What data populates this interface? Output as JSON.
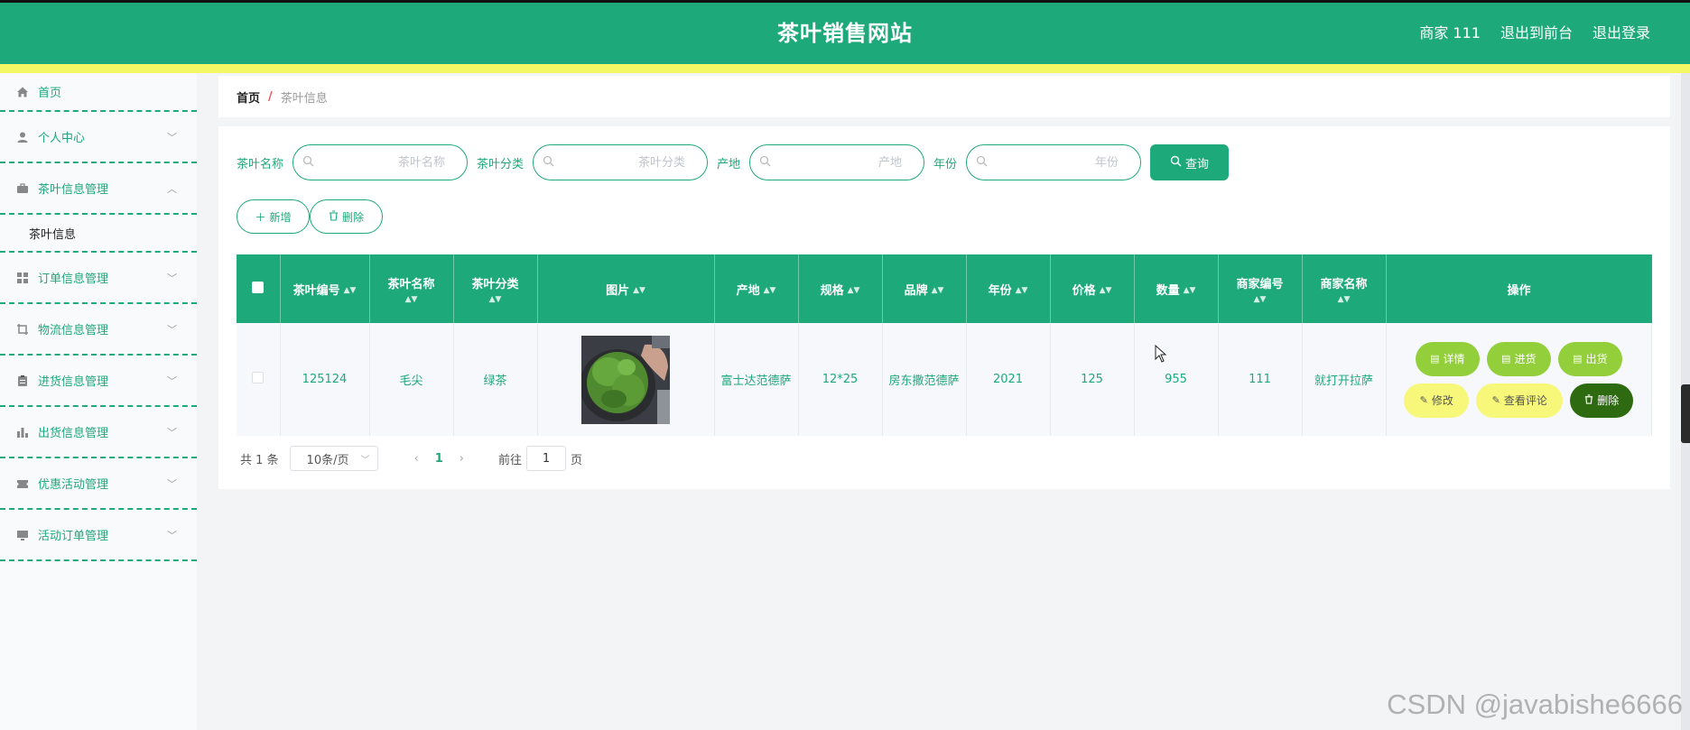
{
  "header": {
    "title": "茶叶销售网站",
    "user": "商家 111",
    "to_front": "退出到前台",
    "logout": "退出登录"
  },
  "sidebar": {
    "items": [
      {
        "label": "首页",
        "icon": "home-icon"
      },
      {
        "label": "个人中心",
        "icon": "user-icon"
      },
      {
        "label": "茶叶信息管理",
        "icon": "briefcase-icon",
        "expanded": true,
        "sub": "茶叶信息"
      },
      {
        "label": "订单信息管理",
        "icon": "grid-icon"
      },
      {
        "label": "物流信息管理",
        "icon": "crop-icon"
      },
      {
        "label": "进货信息管理",
        "icon": "clipboard-icon"
      },
      {
        "label": "出货信息管理",
        "icon": "bar-chart-icon"
      },
      {
        "label": "优惠活动管理",
        "icon": "ticket-icon"
      },
      {
        "label": "活动订单管理",
        "icon": "monitor-icon"
      }
    ]
  },
  "breadcrumb": {
    "home": "首页",
    "sep": "/",
    "current": "茶叶信息"
  },
  "search": {
    "name_label": "茶叶名称",
    "name_placeholder": "茶叶名称",
    "category_label": "茶叶分类",
    "category_placeholder": "茶叶分类",
    "origin_label": "产地",
    "origin_placeholder": "产地",
    "year_label": "年份",
    "year_placeholder": "年份",
    "query": "查询"
  },
  "actions": {
    "add": "新增",
    "delete": "删除"
  },
  "table": {
    "headers": [
      "茶叶编号",
      "茶叶名称",
      "茶叶分类",
      "图片",
      "产地",
      "规格",
      "品牌",
      "年份",
      "价格",
      "数量",
      "商家编号",
      "商家名称",
      "操作"
    ],
    "rows": [
      {
        "code": "125124",
        "name": "毛尖",
        "category": "绿茶",
        "origin": "富士达范德萨",
        "spec": "12*25",
        "brand": "房东撒范德萨",
        "year": "2021",
        "price": "125",
        "quantity": "955",
        "merchant_code": "111",
        "merchant_name": "就打开拉萨",
        "ops": {
          "detail": "详情",
          "stock_in": "进货",
          "stock_out": "出货",
          "edit": "修改",
          "review": "查看评论",
          "delete": "删除"
        }
      }
    ]
  },
  "pagination": {
    "total": "共 1 条",
    "page_size": "10条/页",
    "current_page": "1",
    "goto_label": "前往",
    "goto_value": "1",
    "page_unit": "页"
  },
  "watermark": "CSDN @javabishe6666",
  "colors": {
    "primary": "#1ea97a",
    "yellow_bar": "#f3f765",
    "op_green": "#93cf3a",
    "op_yellow": "#f7f77a",
    "op_dark": "#2e6b10"
  }
}
